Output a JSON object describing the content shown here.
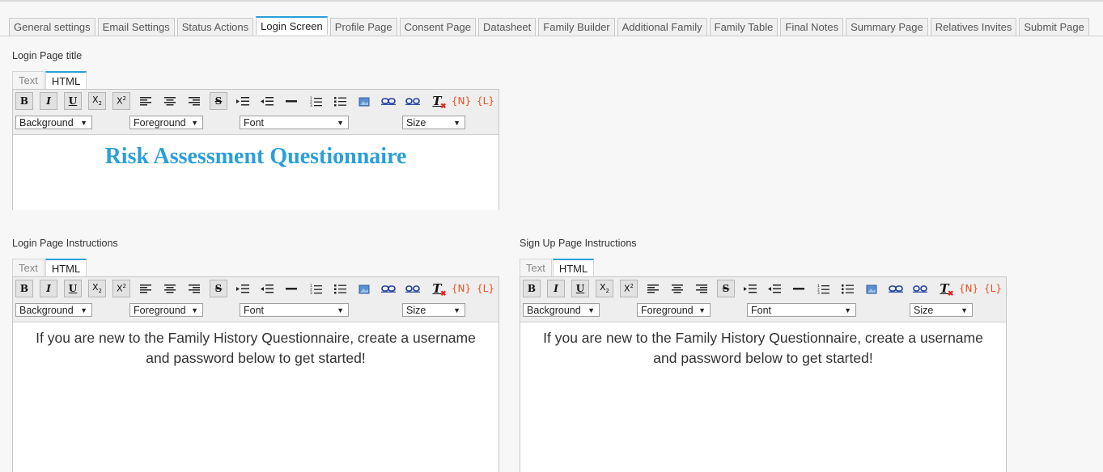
{
  "tabs": [
    {
      "label": "General settings",
      "active": false
    },
    {
      "label": "Email Settings",
      "active": false
    },
    {
      "label": "Status Actions",
      "active": false
    },
    {
      "label": "Login Screen",
      "active": true
    },
    {
      "label": "Profile Page",
      "active": false
    },
    {
      "label": "Consent Page",
      "active": false
    },
    {
      "label": "Datasheet",
      "active": false
    },
    {
      "label": "Family Builder",
      "active": false
    },
    {
      "label": "Additional Family",
      "active": false
    },
    {
      "label": "Family Table",
      "active": false
    },
    {
      "label": "Final Notes",
      "active": false
    },
    {
      "label": "Summary Page",
      "active": false
    },
    {
      "label": "Relatives Invites",
      "active": false
    },
    {
      "label": "Submit Page",
      "active": false
    }
  ],
  "toolbar": {
    "mode_text": "Text",
    "mode_html": "HTML",
    "bold": "B",
    "italic": "I",
    "underline": "U",
    "subscript": "X",
    "subscript_mark": "2",
    "superscript": "X",
    "superscript_mark": "2",
    "strike": "S",
    "clear_format": "T",
    "name_token": "{N}",
    "link_token": "{L}",
    "background": "Background",
    "foreground": "Foreground",
    "font": "Font",
    "size": "Size"
  },
  "login_title": {
    "label": "Login Page title",
    "content": "Risk Assessment Questionnaire"
  },
  "login_instructions": {
    "label": "Login Page Instructions",
    "content_line1": "If you are new to the Family History Questionnaire, create a username",
    "content_line2": "and password below to get started!"
  },
  "signup_instructions": {
    "label": "Sign Up Page Instructions",
    "content_line1": "If you are new to the Family History Questionnaire, create a username",
    "content_line2": "and password below to get started!"
  },
  "colors": {
    "accent": "#2a9fd8",
    "token": "#e8501e"
  }
}
